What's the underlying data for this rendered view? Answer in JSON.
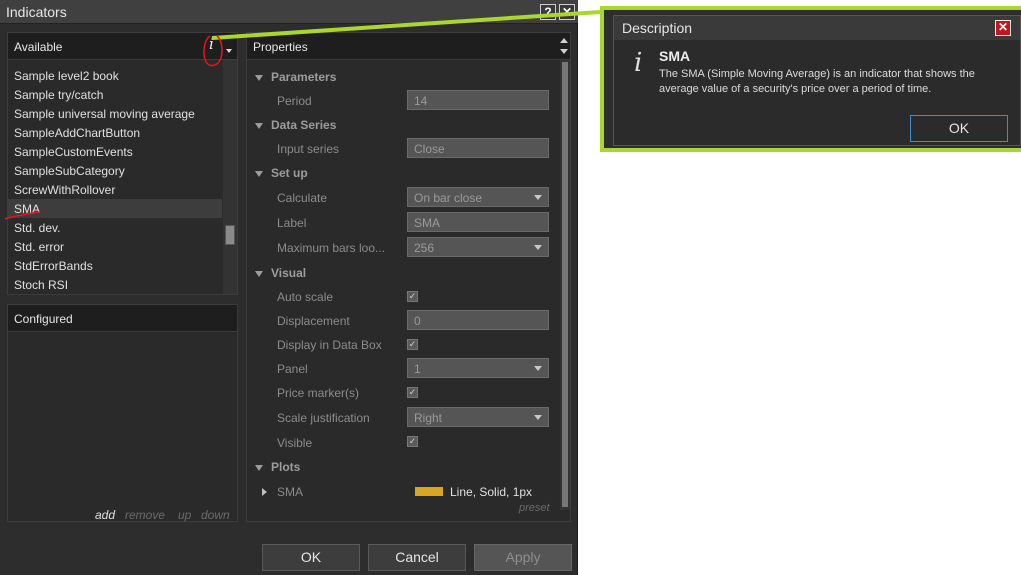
{
  "window": {
    "title": "Indicators",
    "help_label": "?",
    "close_label": "✕"
  },
  "available": {
    "header": "Available",
    "info_label": "i",
    "items": [
      "Sample level2 book",
      "Sample try/catch",
      "Sample universal moving average",
      "SampleAddChartButton",
      "SampleCustomEvents",
      "SampleSubCategory",
      "ScrewWithRollover",
      "SMA",
      "Std. dev.",
      "Std. error",
      "StdErrorBands",
      "Stoch RSI"
    ],
    "selected_index": 7
  },
  "configured": {
    "header": "Configured",
    "add": "add",
    "remove": "remove",
    "up": "up",
    "down": "down"
  },
  "properties": {
    "header": "Properties",
    "parameters": {
      "label": "Parameters",
      "period_label": "Period",
      "period_value": "14"
    },
    "data_series": {
      "label": "Data Series",
      "input_label": "Input series",
      "input_value": "Close"
    },
    "setup": {
      "label": "Set up",
      "calculate_label": "Calculate",
      "calculate_value": "On bar close",
      "label_label": "Label",
      "label_value": "SMA",
      "maxbars_label": "Maximum bars loo...",
      "maxbars_value": "256"
    },
    "visual": {
      "label": "Visual",
      "autoscale_label": "Auto scale",
      "displacement_label": "Displacement",
      "displacement_value": "0",
      "databox_label": "Display in Data Box",
      "panel_label": "Panel",
      "panel_value": "1",
      "pricemarker_label": "Price marker(s)",
      "scalejust_label": "Scale justification",
      "scalejust_value": "Right",
      "visible_label": "Visible",
      "checkmark": "✓"
    },
    "plots": {
      "label": "Plots",
      "sma_label": "SMA",
      "sma_style": "Line, Solid, 1px",
      "sma_color": "#daa520"
    },
    "preset": "preset"
  },
  "buttons": {
    "ok": "OK",
    "cancel": "Cancel",
    "apply": "Apply"
  },
  "description": {
    "title": "Description",
    "close_label": "✕",
    "icon_glyph": "i",
    "name": "SMA",
    "text": "The SMA (Simple Moving Average) is an indicator that shows the average value of a security's price over a period of time.",
    "ok": "OK"
  },
  "colors": {
    "callout": "#a9d62f",
    "annotation_red": "#e8141b",
    "accent_blue": "#3a8fd4"
  }
}
